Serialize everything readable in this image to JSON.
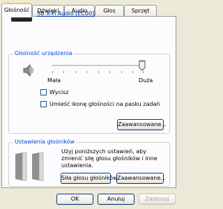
{
  "tabs": [
    {
      "label": "Głośność",
      "active": true
    },
    {
      "label": "Dźwięki",
      "active": false
    },
    {
      "label": "Audio",
      "active": false
    },
    {
      "label": "Głos",
      "active": false
    },
    {
      "label": "Sprzęt",
      "active": false
    }
  ],
  "device": {
    "icon": "creative-xfi-logo",
    "icon_text": "X-Fi",
    "name": "SB X-Fi Audio [EC00]"
  },
  "volume_group": {
    "title": "Głośność urządzenia",
    "icon": "speaker-icon",
    "slider": {
      "min_label": "Mała",
      "max_label": "Duża",
      "value_fraction": 1.0
    },
    "mute_checkbox": {
      "label": "Wycisz",
      "checked": false
    },
    "tray_checkbox": {
      "label": "Umieść ikonę głośności na pasku zadań",
      "checked": false
    },
    "advanced_button": "Zaawansowane..."
  },
  "speaker_group": {
    "title": "Ustawienia głośników",
    "icon": "speakers-icon",
    "description": "Użyj poniższych ustawień, aby zmienić siłę głosu głośników i inne ustawienia.",
    "volume_button": "Siła głosu głośników...",
    "advanced_button": "Zaawansowane..."
  },
  "footer": {
    "ok": "OK",
    "cancel": "Anuluj",
    "apply": "Zastosuj"
  }
}
